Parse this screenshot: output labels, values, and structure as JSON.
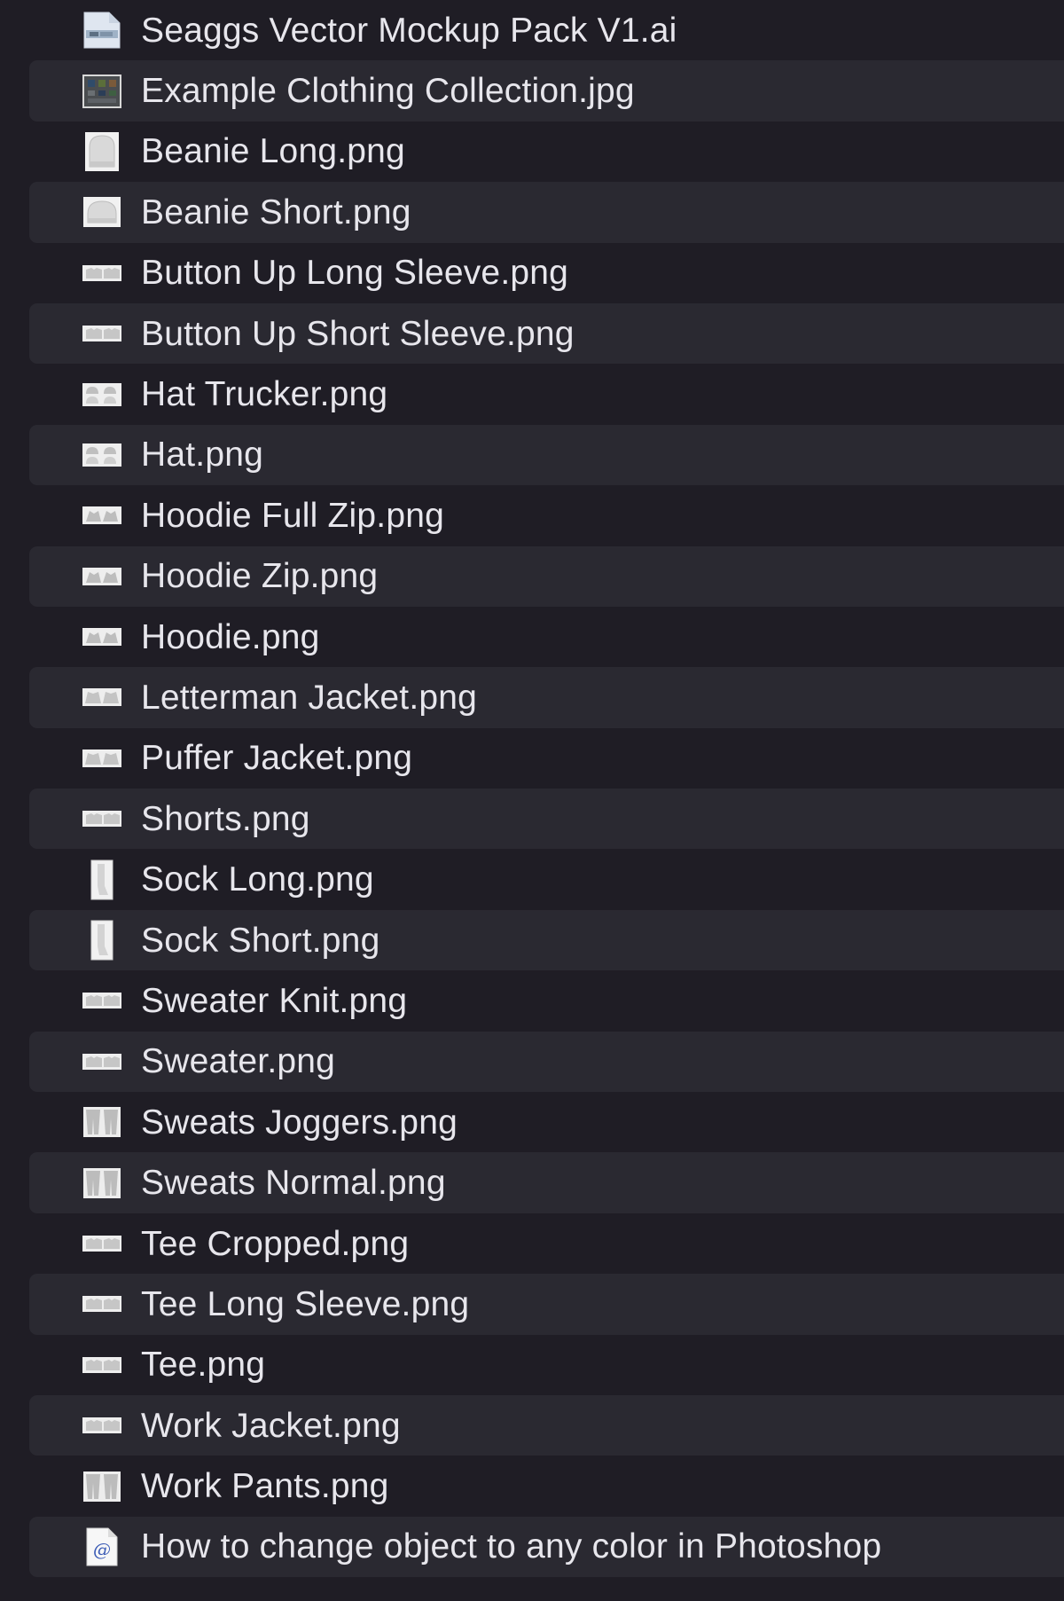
{
  "files": [
    {
      "name": "Seaggs Vector Mockup Pack V1.ai",
      "icon": "ai-document-icon"
    },
    {
      "name": "Example Clothing Collection.jpg",
      "icon": "collection-image-icon"
    },
    {
      "name": "Beanie Long.png",
      "icon": "beanie-long-icon"
    },
    {
      "name": "Beanie Short.png",
      "icon": "beanie-short-icon"
    },
    {
      "name": "Button Up Long Sleeve.png",
      "icon": "garment-strip-icon"
    },
    {
      "name": "Button Up Short Sleeve.png",
      "icon": "garment-strip-icon"
    },
    {
      "name": "Hat Trucker.png",
      "icon": "hat-icon"
    },
    {
      "name": "Hat.png",
      "icon": "hat-icon"
    },
    {
      "name": "Hoodie Full Zip.png",
      "icon": "hoodie-icon"
    },
    {
      "name": "Hoodie Zip.png",
      "icon": "hoodie-icon"
    },
    {
      "name": "Hoodie.png",
      "icon": "hoodie-icon"
    },
    {
      "name": "Letterman Jacket.png",
      "icon": "jacket-icon"
    },
    {
      "name": "Puffer Jacket.png",
      "icon": "jacket-icon"
    },
    {
      "name": "Shorts.png",
      "icon": "garment-strip-icon"
    },
    {
      "name": "Sock Long.png",
      "icon": "sock-icon"
    },
    {
      "name": "Sock Short.png",
      "icon": "sock-icon"
    },
    {
      "name": "Sweater Knit.png",
      "icon": "garment-strip-icon"
    },
    {
      "name": "Sweater.png",
      "icon": "garment-strip-icon"
    },
    {
      "name": "Sweats Joggers.png",
      "icon": "pants-icon"
    },
    {
      "name": "Sweats Normal.png",
      "icon": "pants-icon"
    },
    {
      "name": "Tee Cropped.png",
      "icon": "garment-strip-icon"
    },
    {
      "name": "Tee Long Sleeve.png",
      "icon": "garment-strip-icon"
    },
    {
      "name": "Tee.png",
      "icon": "garment-strip-icon"
    },
    {
      "name": "Work Jacket.png",
      "icon": "garment-strip-icon"
    },
    {
      "name": "Work Pants.png",
      "icon": "pants-icon"
    },
    {
      "name": "How to change object to any color in Photoshop",
      "icon": "web-location-icon"
    }
  ],
  "colors": {
    "background": "#1f1d25",
    "alt_row": "#2a2931",
    "text": "#e7e6ec"
  }
}
